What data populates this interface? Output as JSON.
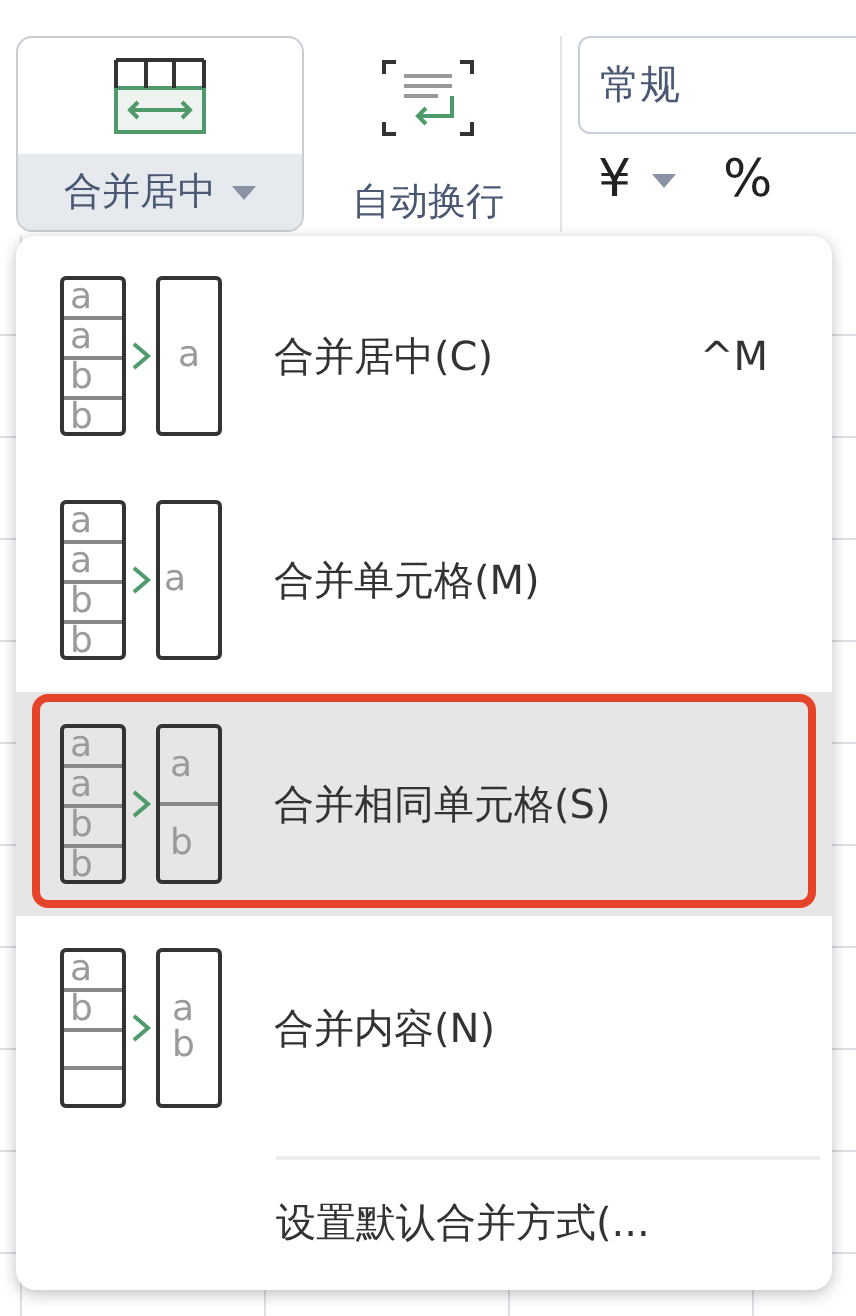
{
  "toolbar": {
    "merge_button": {
      "label": "合并居中",
      "expanded": true
    },
    "wrap_button": {
      "label": "自动换行"
    },
    "format_field": {
      "value": "常规"
    },
    "currency_button": {
      "label": "¥"
    },
    "percent_button": {
      "label": "%"
    }
  },
  "menu": {
    "items": [
      {
        "label": "合并居中(C)",
        "shortcut": "^M",
        "selected": false,
        "source": [
          "a",
          "a",
          "b",
          "b"
        ],
        "result": {
          "kind": "center",
          "cells": [
            "a"
          ]
        }
      },
      {
        "label": "合并单元格(M)",
        "selected": false,
        "source": [
          "a",
          "a",
          "b",
          "b"
        ],
        "result": {
          "kind": "left",
          "cells": [
            "a"
          ]
        }
      },
      {
        "label": "合并相同单元格(S)",
        "selected": true,
        "source": [
          "a",
          "a",
          "b",
          "b"
        ],
        "result": {
          "kind": "split",
          "cells": [
            "a",
            "b"
          ]
        }
      },
      {
        "label": "合并内容(N)",
        "selected": false,
        "source": [
          "a",
          "b"
        ],
        "result": {
          "kind": "stack",
          "cells": [
            "a",
            "b"
          ]
        }
      }
    ],
    "footer": {
      "label": "设置默认合并方式(..."
    }
  }
}
